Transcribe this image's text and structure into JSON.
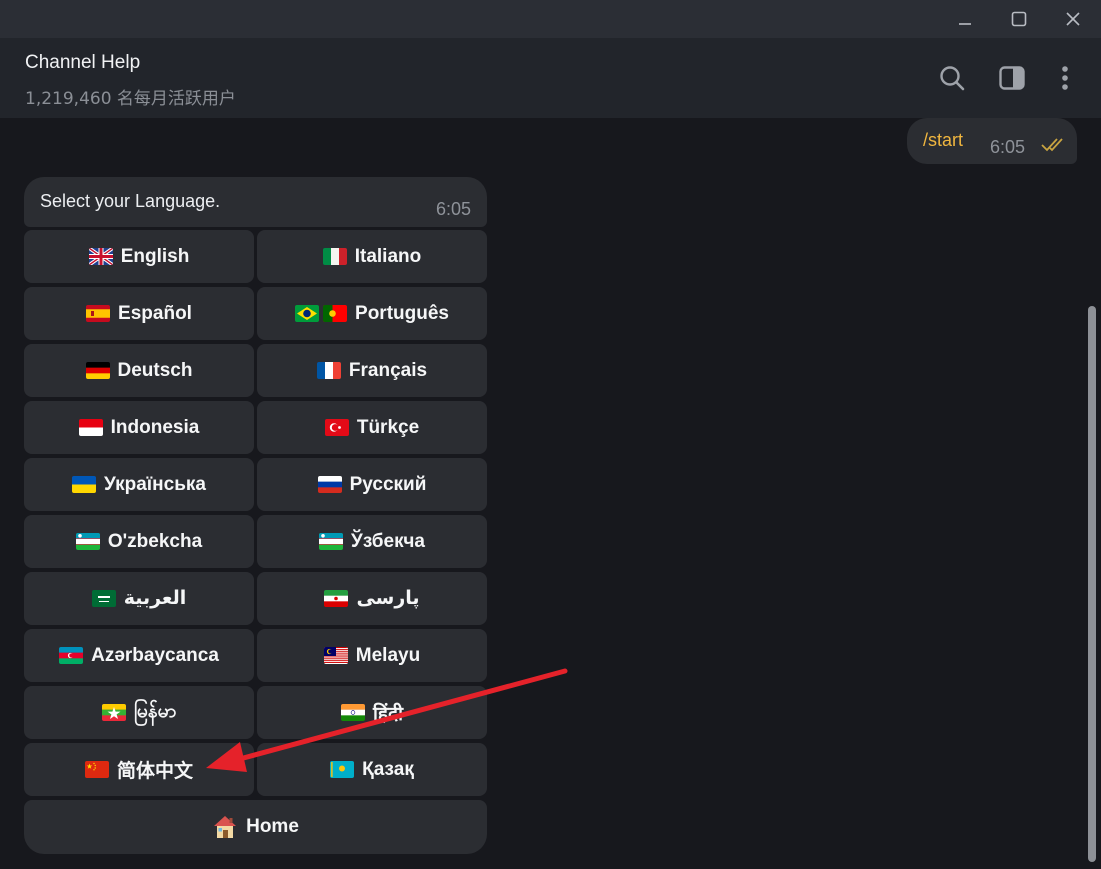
{
  "window": {
    "controls": [
      "minimize",
      "maximize",
      "close"
    ]
  },
  "header": {
    "title": "Channel Help",
    "subtitle": "1,219,460 名每月活跃用户"
  },
  "outgoing": {
    "text": "/start",
    "time": "6:05"
  },
  "incoming": {
    "text": "Select your Language.",
    "time": "6:05"
  },
  "keyboard": {
    "buttons": [
      {
        "label": "English",
        "flags": [
          "gb"
        ]
      },
      {
        "label": "Italiano",
        "flags": [
          "it"
        ]
      },
      {
        "label": "Español",
        "flags": [
          "es"
        ]
      },
      {
        "label": "Português",
        "flags": [
          "br",
          "pt"
        ]
      },
      {
        "label": "Deutsch",
        "flags": [
          "de"
        ]
      },
      {
        "label": "Français",
        "flags": [
          "fr"
        ]
      },
      {
        "label": "Indonesia",
        "flags": [
          "id"
        ]
      },
      {
        "label": "Türkçe",
        "flags": [
          "tr"
        ]
      },
      {
        "label": "Українська",
        "flags": [
          "ua"
        ]
      },
      {
        "label": "Русский",
        "flags": [
          "ru"
        ]
      },
      {
        "label": "O'zbekcha",
        "flags": [
          "uz"
        ]
      },
      {
        "label": "Ўзбекча",
        "flags": [
          "uz"
        ]
      },
      {
        "label": "العربية",
        "flags": [
          "sa"
        ]
      },
      {
        "label": "پارسی",
        "flags": [
          "ir"
        ]
      },
      {
        "label": "Azərbaycanca",
        "flags": [
          "az"
        ]
      },
      {
        "label": "Melayu",
        "flags": [
          "my"
        ]
      },
      {
        "label": "မြန်မာ",
        "flags": [
          "mm"
        ]
      },
      {
        "label": "हिंदी",
        "flags": [
          "in"
        ]
      },
      {
        "label": "简体中文",
        "flags": [
          "cn"
        ]
      },
      {
        "label": "Қазақ",
        "flags": [
          "kz"
        ]
      }
    ],
    "home": {
      "label": "Home",
      "icon": "house-icon"
    }
  },
  "colors": {
    "background": "#17181d",
    "bubble": "#2b2d32",
    "command_text": "#f0b63f",
    "annotation_arrow": "#e5222a"
  }
}
